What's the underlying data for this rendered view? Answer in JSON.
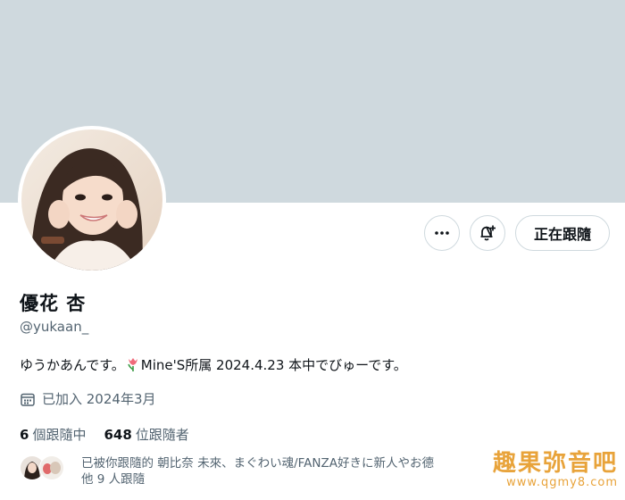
{
  "profile": {
    "display_name": "優花 杏",
    "handle": "@yukaan_",
    "bio_before": "ゆうかあんです。",
    "bio_after": "Mine'S所属 2024.4.23 本中でびゅーです。",
    "joined": "已加入 2024年3月"
  },
  "actions": {
    "more_icon": "more-horizontal-icon",
    "notify_icon": "bell-plus-icon",
    "follow_label": "正在跟隨"
  },
  "stats": {
    "following_count": "6",
    "following_label": "個跟隨中",
    "followers_count": "648",
    "followers_label": "位跟隨者"
  },
  "known_followers": {
    "line1": "已被你跟隨的 朝比奈 未來、まぐわい魂/FANZA好きに新人やお德",
    "line2": "他 9 人跟隨"
  },
  "watermark": {
    "title": "趣果弥音吧",
    "url": "www.qgmy8.com"
  },
  "colors": {
    "banner": "#cfd9de",
    "text_primary": "#0f1419",
    "text_secondary": "#536471",
    "border": "#cfd9de",
    "watermark": "#e8a33a"
  }
}
